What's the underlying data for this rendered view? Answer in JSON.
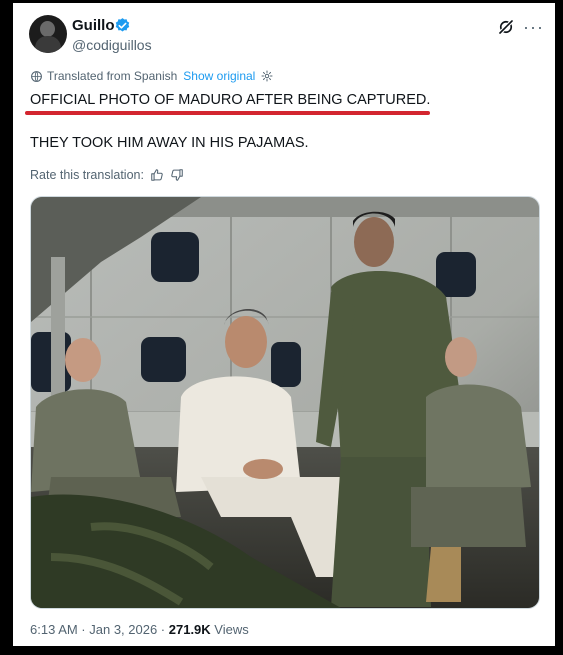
{
  "post": {
    "author_name": "Guillo",
    "author_handle": "@codiguillos",
    "translated_label": "Translated from Spanish",
    "show_original": "Show original",
    "text_line1": "OFFICIAL PHOTO OF MADURO AFTER BEING CAPTURED.",
    "text_line2": "THEY TOOK HIM AWAY IN HIS PAJAMAS.",
    "rate_label": "Rate this translation:",
    "timestamp": "6:13 AM · Jan 3, 2026 · ",
    "views_count": "271.9K",
    "views_label": " Views"
  },
  "colors": {
    "accent": "#1d9bf0",
    "annotation_underline": "#d3252f"
  },
  "icons": {
    "verified": "verified-badge-icon",
    "grok": "grok-icon",
    "more": "more-icon",
    "translate": "globe-icon",
    "settings": "gear-icon",
    "thumbs_up": "thumbs-up-icon",
    "thumbs_down": "thumbs-down-icon"
  }
}
